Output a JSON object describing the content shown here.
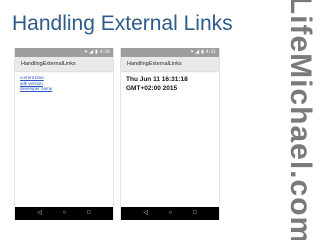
{
  "slide": {
    "title": "Handling External Links",
    "watermark": "LifeMichael.com"
  },
  "left_phone": {
    "status_time": "4:36",
    "app_title": "HandlingExternalLinks",
    "links": [
      "current time",
      "sdk version",
      "developer name"
    ],
    "nav": {
      "back": "◁",
      "home": "○",
      "recents": "□"
    }
  },
  "right_phone": {
    "status_time": "4:31",
    "app_title": "HandlingExternalLinks",
    "date_line1": "Thu Jun 11 16:31:18",
    "date_line2": "GMT+02:00 2015",
    "nav": {
      "back": "◁",
      "home": "○",
      "recents": "□"
    }
  },
  "icons": {
    "wifi": "wifi-icon",
    "signal": "signal-icon",
    "battery": "battery-icon"
  }
}
